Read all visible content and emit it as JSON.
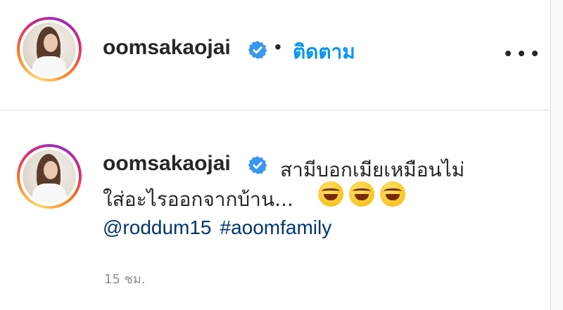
{
  "header": {
    "username": "oomsakaojai",
    "separator": "•",
    "follow_label": "ติดตาม",
    "more_icon": "more-horizontal-icon"
  },
  "comment": {
    "username": "oomsakaojai",
    "caption_line1": "สามีบอกเมียเหมือนไม่",
    "caption_line2": "ใส่อะไรออกจากบ้าน...",
    "emojis": [
      "rolling-on-floor-laughing",
      "rolling-on-floor-laughing",
      "rolling-on-floor-laughing"
    ],
    "mention": "@roddum15",
    "hashtag": "#aoomfamily",
    "timestamp": "15 ชม."
  },
  "colors": {
    "link_blue": "#0095f6",
    "tag_color": "#00376b",
    "verified_blue": "#3897f0",
    "muted": "#8e8e8e"
  }
}
